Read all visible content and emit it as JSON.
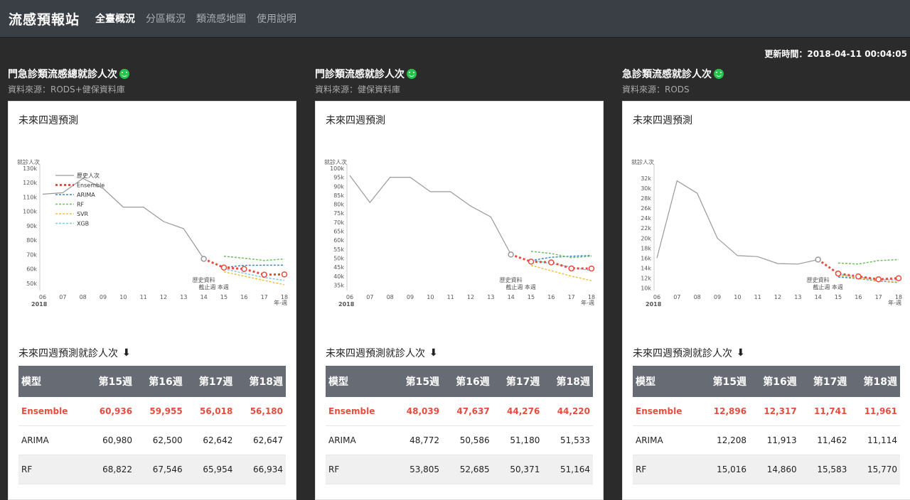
{
  "nav": {
    "brand": "流感預報站",
    "items": [
      "全臺概況",
      "分區概況",
      "類流感地圖",
      "使用說明"
    ]
  },
  "updated": "更新時間：2018-04-11 00:04:05",
  "labels": {
    "forecast": "未來四週預測",
    "table_title": "未來四週預測就診人次",
    "y_unit": "就診人次",
    "x_unit": "年-週",
    "year": "2018",
    "hist_mark": "歷史資料\n截止週 本週"
  },
  "legend": [
    "歷史人次",
    "Ensemble",
    "ARIMA",
    "RF",
    "SVR",
    "XGB"
  ],
  "colors": {
    "history": "#999999",
    "Ensemble": "#e74c3c",
    "ARIMA": "#3a87c8",
    "RF": "#6fbf5f",
    "SVR": "#f0c040",
    "XGB": "#7ec8e3"
  },
  "table_headers": [
    "模型",
    "第15週",
    "第16週",
    "第17週",
    "第18週"
  ],
  "panels": [
    {
      "title": "門急診類流感總就診人次",
      "source": "資料來源：RODS+健保資料庫",
      "rows": [
        [
          "Ensemble",
          "60,936",
          "59,955",
          "56,018",
          "56,180"
        ],
        [
          "ARIMA",
          "60,980",
          "62,500",
          "62,642",
          "62,647"
        ],
        [
          "RF",
          "68,822",
          "67,546",
          "65,954",
          "66,934"
        ]
      ],
      "chart_data": {
        "type": "line",
        "x": [
          "06",
          "07",
          "08",
          "09",
          "10",
          "11",
          "12",
          "13",
          "14",
          "15",
          "16",
          "17",
          "18"
        ],
        "yticks": [
          "50k",
          "60k",
          "70k",
          "80k",
          "90k",
          "100k",
          "110k",
          "120k",
          "130k"
        ],
        "ylim": [
          45000,
          130000
        ],
        "history": [
          112000,
          113000,
          123000,
          116000,
          103000,
          103000,
          93000,
          88000,
          67000
        ],
        "series": [
          {
            "name": "Ensemble",
            "values": [
              67000,
              60936,
              59955,
              56018,
              56180
            ]
          },
          {
            "name": "ARIMA",
            "values": [
              null,
              61000,
              62500,
              62600,
              62600
            ]
          },
          {
            "name": "RF",
            "values": [
              null,
              68800,
              67500,
              65900,
              66900
            ]
          },
          {
            "name": "SVR",
            "values": [
              null,
              58000,
              55000,
              52000,
              49000
            ]
          },
          {
            "name": "XGB",
            "values": [
              null,
              60000,
              57000,
              54000,
              52000
            ]
          }
        ]
      }
    },
    {
      "title": "門診類流感就診人次",
      "source": "資料來源：健保資料庫",
      "rows": [
        [
          "Ensemble",
          "48,039",
          "47,637",
          "44,276",
          "44,220"
        ],
        [
          "ARIMA",
          "48,772",
          "50,586",
          "51,180",
          "51,533"
        ],
        [
          "RF",
          "53,805",
          "52,685",
          "50,371",
          "51,164"
        ]
      ],
      "chart_data": {
        "type": "line",
        "x": [
          "06",
          "07",
          "08",
          "09",
          "10",
          "11",
          "12",
          "13",
          "14",
          "15",
          "16",
          "17",
          "18"
        ],
        "yticks": [
          "35k",
          "40k",
          "45k",
          "50k",
          "55k",
          "60k",
          "65k",
          "70k",
          "75k",
          "80k",
          "85k",
          "90k",
          "95k",
          "100k"
        ],
        "ylim": [
          32000,
          100000
        ],
        "history": [
          96000,
          81000,
          95000,
          95000,
          87000,
          87000,
          79000,
          73000,
          52000
        ],
        "series": [
          {
            "name": "Ensemble",
            "values": [
              52000,
              48039,
              47637,
              44276,
              44220
            ]
          },
          {
            "name": "ARIMA",
            "values": [
              null,
              48700,
              50500,
              51100,
              51500
            ]
          },
          {
            "name": "RF",
            "values": [
              null,
              53800,
              52600,
              50300,
              51100
            ]
          },
          {
            "name": "SVR",
            "values": [
              null,
              46000,
              43000,
              40000,
              37500
            ]
          },
          {
            "name": "XGB",
            "values": [
              null,
              49000,
              47000,
              45000,
              43000
            ]
          }
        ]
      }
    },
    {
      "title": "急診類流感就診人次",
      "source": "資料來源：RODS",
      "rows": [
        [
          "Ensemble",
          "12,896",
          "12,317",
          "11,741",
          "11,961"
        ],
        [
          "ARIMA",
          "12,208",
          "11,913",
          "11,462",
          "11,114"
        ],
        [
          "RF",
          "15,016",
          "14,860",
          "15,583",
          "15,770"
        ]
      ],
      "chart_data": {
        "type": "line",
        "x": [
          "06",
          "07",
          "08",
          "09",
          "10",
          "11",
          "12",
          "13",
          "14",
          "15",
          "16",
          "17",
          "18"
        ],
        "yticks": [
          "10k",
          "12k",
          "14k",
          "16k",
          "18k",
          "20k",
          "22k",
          "24k",
          "26k",
          "28k",
          "30k",
          "32k"
        ],
        "ylim": [
          9500,
          34000
        ],
        "history": [
          16000,
          31500,
          29000,
          20000,
          16500,
          16300,
          14900,
          14800,
          15700
        ],
        "series": [
          {
            "name": "Ensemble",
            "values": [
              15700,
              12896,
              12317,
              11741,
              11961
            ]
          },
          {
            "name": "ARIMA",
            "values": [
              null,
              12200,
              11900,
              11400,
              11100
            ]
          },
          {
            "name": "RF",
            "values": [
              null,
              15000,
              14800,
              15500,
              15700
            ]
          },
          {
            "name": "SVR",
            "values": [
              null,
              12500,
              12000,
              11500,
              11200
            ]
          },
          {
            "name": "XGB",
            "values": [
              null,
              12800,
              12200,
              11700,
              11600
            ]
          }
        ]
      }
    }
  ]
}
